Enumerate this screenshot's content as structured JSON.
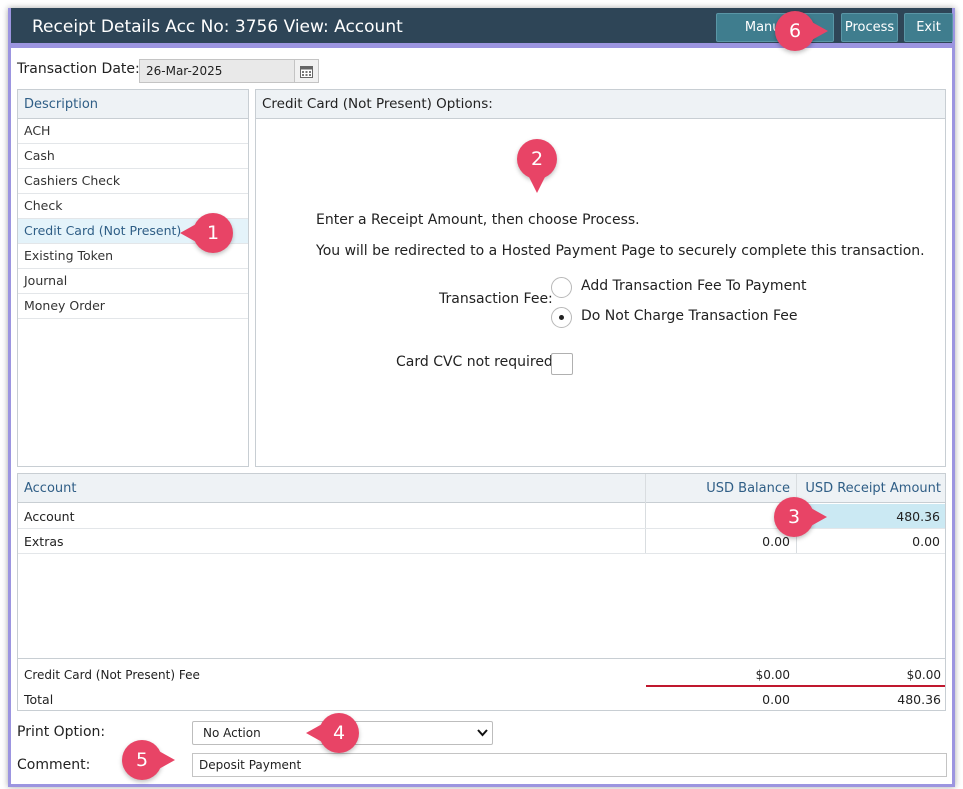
{
  "window": {
    "title": "Receipt Details Acc No: 3756 View: Account",
    "buttons": {
      "manual": "Manual A",
      "process": "Process",
      "exit": "Exit"
    }
  },
  "transaction": {
    "label": "Transaction Date:",
    "value": "26-Mar-2025"
  },
  "methods": {
    "header": "Description",
    "items": [
      "ACH",
      "Cash",
      "Cashiers Check",
      "Check",
      "Credit Card (Not Present)",
      "Existing Token",
      "Journal",
      "Money Order"
    ],
    "selected": "Credit Card (Not Present)"
  },
  "options": {
    "header": "Credit Card (Not Present) Options:",
    "line1": "Enter a Receipt Amount, then choose Process.",
    "line2": "You will be redirected to a Hosted Payment Page to securely complete this transaction.",
    "fee_label": "Transaction Fee:",
    "fee_add": "Add Transaction Fee To Payment",
    "fee_none": "Do Not Charge Transaction Fee",
    "fee_selected": "Do Not Charge Transaction Fee",
    "cvc_label": "Card CVC not required:",
    "cvc_checked": false
  },
  "table": {
    "headers": {
      "account": "Account",
      "balance": "USD Balance",
      "receipt": "USD Receipt Amount"
    },
    "rows": [
      {
        "account": "Account",
        "balance": "0",
        "receipt": "480.36"
      },
      {
        "account": "Extras",
        "balance": "0.00",
        "receipt": "0.00"
      }
    ],
    "fee": {
      "label": "Credit Card (Not Present) Fee",
      "balance": "$0.00",
      "receipt": "$0.00"
    },
    "total": {
      "label": "Total",
      "balance": "0.00",
      "receipt": "480.36"
    }
  },
  "print": {
    "label": "Print Option:",
    "value": "No Action"
  },
  "comment": {
    "label": "Comment:",
    "value": "Deposit Payment"
  },
  "markers": [
    "1",
    "2",
    "3",
    "4",
    "5",
    "6"
  ],
  "colors": {
    "titlebar": "#2e4557",
    "button": "#3f7d8e",
    "accent_border": "#9c95e0",
    "marker": "#e84466",
    "selected_row": "#e4f3fa",
    "total_line": "#c0182e"
  },
  "icons": {
    "date_picker": "calendar-icon",
    "select": "chevron-down-icon"
  }
}
